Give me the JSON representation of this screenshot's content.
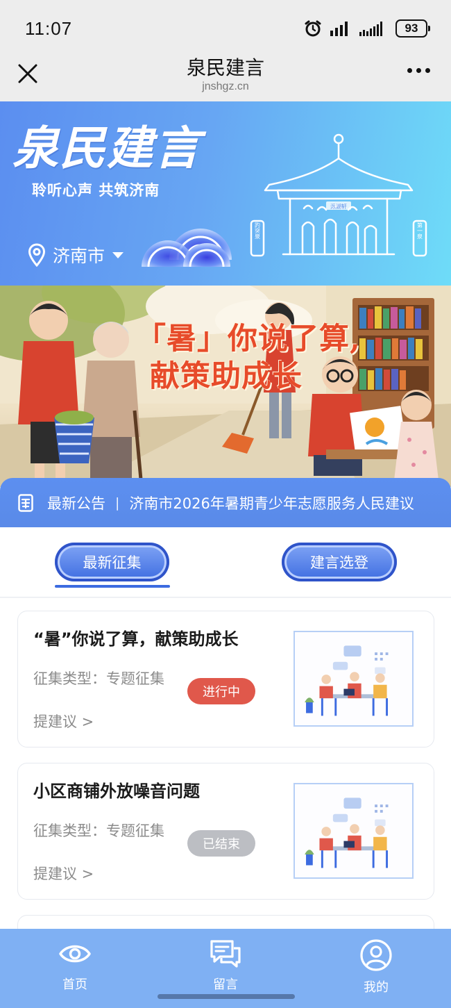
{
  "status_bar": {
    "time": "11:07",
    "battery": "93"
  },
  "nav": {
    "title": "泉民建言",
    "domain": "jnshgz.cn"
  },
  "hero": {
    "title": "泉民建言",
    "slogan": "聆听心声 共筑济南",
    "city": "济南市",
    "pavilion_sign": "泺湖轩",
    "left_sign": "趵突泉",
    "right_sign": "第一泉"
  },
  "banner": {
    "line1": "「暑」你说了算,",
    "line2": "献策助成长"
  },
  "notice": {
    "label": "最新公告",
    "separator": "|",
    "text": "济南市2026年暑期青少年志愿服务人民建议"
  },
  "tabs": [
    {
      "label": "最新征集"
    },
    {
      "label": "建言选登"
    }
  ],
  "cards": [
    {
      "title": "“暑”你说了算，献策助成长",
      "type": "征集类型：专题征集",
      "status": "进行中",
      "link": "提建议 >"
    },
    {
      "title": "小区商铺外放噪音问题",
      "type": "征集类型：专题征集",
      "status": "已结束",
      "link": "提建议 >"
    }
  ],
  "bottom_nav": [
    {
      "label": "首页",
      "icon": "eye-icon"
    },
    {
      "label": "留言",
      "icon": "message-icon"
    },
    {
      "label": "我的",
      "icon": "user-icon"
    }
  ],
  "colors": {
    "primary": "#5c8ff0",
    "active_badge": "#e0584b",
    "ended_badge": "#bcbec3",
    "bottom_nav": "#7fb0f3"
  }
}
